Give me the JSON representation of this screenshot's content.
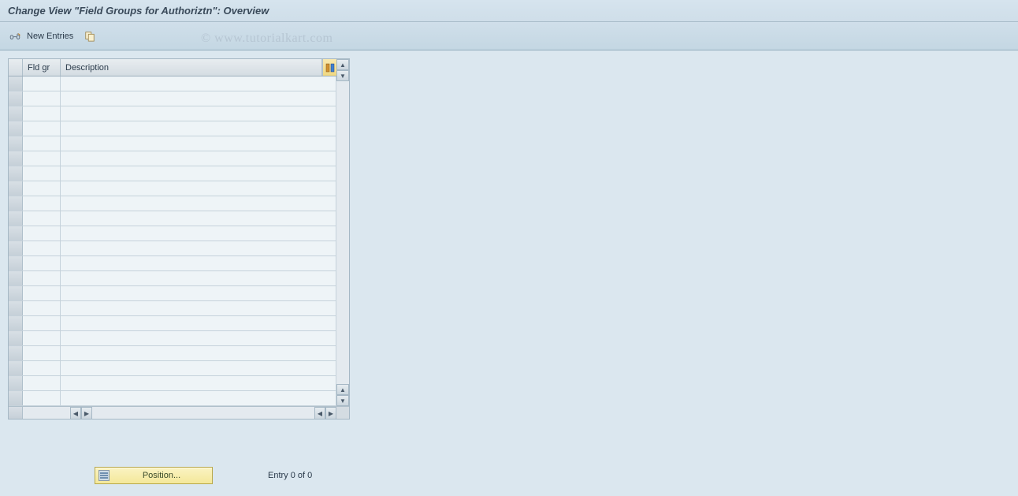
{
  "title": "Change View \"Field Groups for Authoriztn\": Overview",
  "toolbar": {
    "new_entries_label": "New Entries"
  },
  "watermark": "© www.tutorialkart.com",
  "table": {
    "columns": {
      "fld_gr": "Fld gr",
      "description": "Description"
    },
    "row_count": 22
  },
  "footer": {
    "position_label": "Position...",
    "entry_status": "Entry 0 of 0"
  }
}
